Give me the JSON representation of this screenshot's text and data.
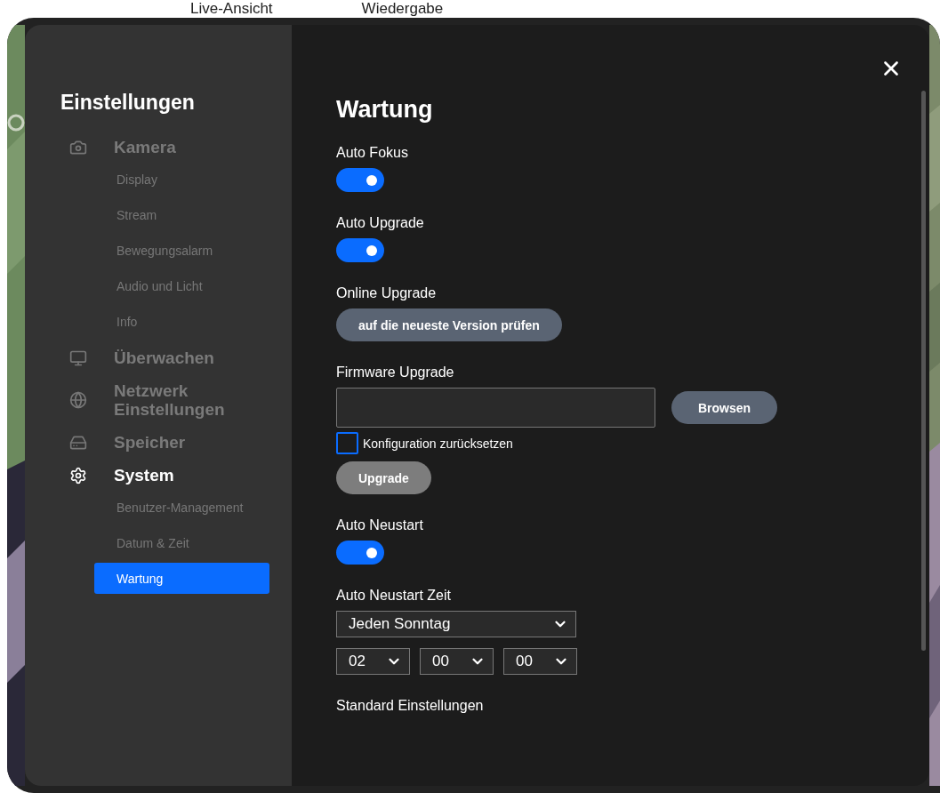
{
  "tabs": [
    {
      "label": "Live-Ansicht"
    },
    {
      "label": "Wiedergabe"
    }
  ],
  "sidebar": {
    "title": "Einstellungen",
    "groups": [
      {
        "label": "Kamera",
        "active": false,
        "items": [
          {
            "label": "Display",
            "selected": false
          },
          {
            "label": "Stream",
            "selected": false
          },
          {
            "label": "Bewegungsalarm",
            "selected": false
          },
          {
            "label": "Audio und Licht",
            "selected": false
          },
          {
            "label": "Info",
            "selected": false
          }
        ]
      },
      {
        "label": "Überwachen",
        "active": false
      },
      {
        "label": "Netzwerk Einstellungen",
        "active": false
      },
      {
        "label": "Speicher",
        "active": false
      },
      {
        "label": "System",
        "active": true,
        "items": [
          {
            "label": "Benutzer-Management",
            "selected": false
          },
          {
            "label": "Datum & Zeit",
            "selected": false
          },
          {
            "label": "Wartung",
            "selected": true
          }
        ]
      }
    ]
  },
  "main": {
    "title": "Wartung",
    "sections": [
      {
        "kind": "toggle",
        "label": "Auto Fokus",
        "on": true
      },
      {
        "kind": "toggle",
        "label": "Auto Upgrade",
        "on": true
      },
      {
        "kind": "button",
        "label": "Online Upgrade",
        "button": "auf die neueste Version prüfen"
      },
      {
        "kind": "firmware",
        "label": "Firmware Upgrade",
        "browse": "Browsen",
        "checkbox": {
          "label": "Konfiguration zurücksetzen",
          "checked": false
        },
        "upgrade": "Upgrade"
      },
      {
        "kind": "toggle",
        "label": "Auto Neustart",
        "on": true
      },
      {
        "kind": "schedule",
        "label": "Auto Neustart Zeit",
        "day": "Jeden Sonntag",
        "times": [
          "02",
          "00",
          "00"
        ]
      },
      {
        "kind": "heading",
        "label": "Standard Einstellungen"
      }
    ]
  }
}
